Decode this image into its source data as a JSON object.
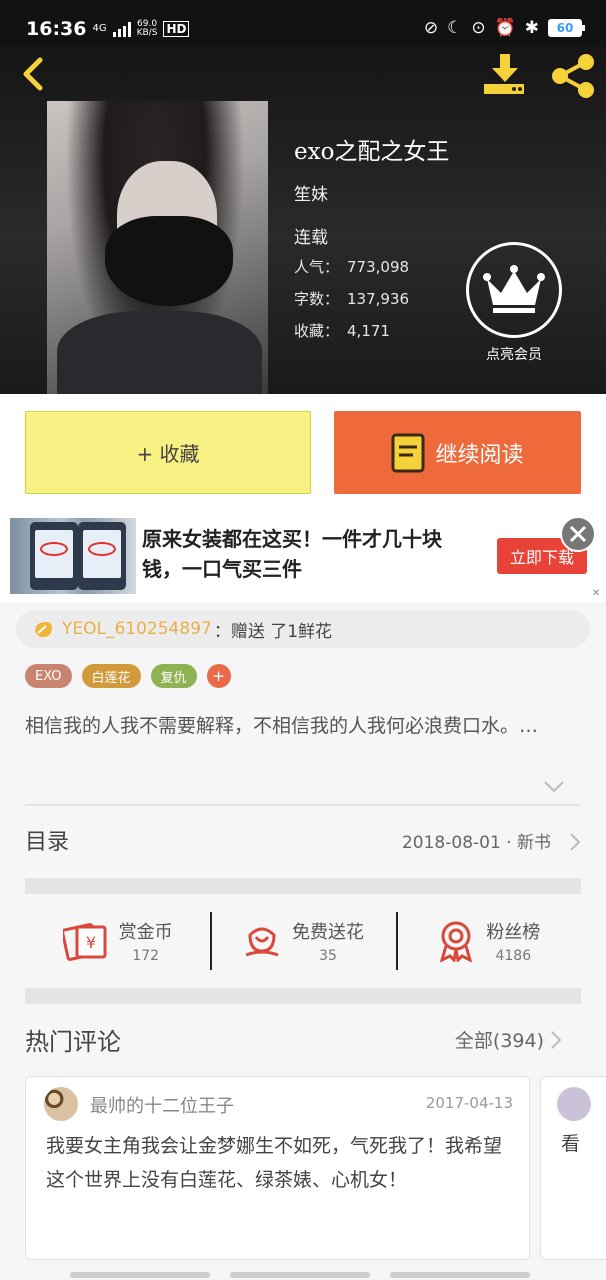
{
  "status_bar": {
    "time": "16:36",
    "network": "4G",
    "speed_value": "69.0",
    "speed_unit": "KB/S",
    "hd": "HD",
    "battery": "60"
  },
  "book": {
    "title": "exo之配之女王",
    "author": "笙妹",
    "status": "连载",
    "popularity_label": "人气：",
    "popularity_value": "773,098",
    "words_label": "字数：",
    "words_value": "137,936",
    "collect_label": "收藏：",
    "collect_value": "4,171"
  },
  "vip": {
    "label": "点亮会员"
  },
  "actions": {
    "favorite_label": "+ 收藏",
    "read_label": "继续阅读"
  },
  "ad": {
    "text": "原来女装都在这买！一件才几十块钱，一口气买三件",
    "button": "立即下载",
    "close_small": "✕"
  },
  "gift": {
    "user": "YEOL_610254897",
    "action": "：赠送 了1鲜花"
  },
  "tags": [
    {
      "label": "EXO",
      "color": "#c9846f"
    },
    {
      "label": "白莲花",
      "color": "#d39a3c"
    },
    {
      "label": "复仇",
      "color": "#8fb352"
    }
  ],
  "tag_add": "+",
  "intro": "相信我的人我不需要解释，不相信我的人我何必浪费口水。…",
  "catalog": {
    "label": "目录",
    "meta": "2018-08-01 · 新书"
  },
  "stats": [
    {
      "title": "赏金币",
      "value": "172",
      "icon": "gold-coin-icon"
    },
    {
      "title": "免费送花",
      "value": "35",
      "icon": "flower-icon"
    },
    {
      "title": "粉丝榜",
      "value": "4186",
      "icon": "badge-icon"
    }
  ],
  "comments": {
    "title": "热门评论",
    "all": "全部(394)",
    "items": [
      {
        "user": "最帅的十二位王子",
        "date": "2017-04-13",
        "text": "我要女主角我会让金梦娜生不如死，气死我了！我希望这个世界上没有白莲花、绿茶婊、心机女！"
      },
      {
        "text": "看"
      }
    ]
  },
  "colors": {
    "accent_yellow": "#f8f184",
    "accent_orange": "#ef6a3b",
    "icon_red": "#d9483a"
  }
}
